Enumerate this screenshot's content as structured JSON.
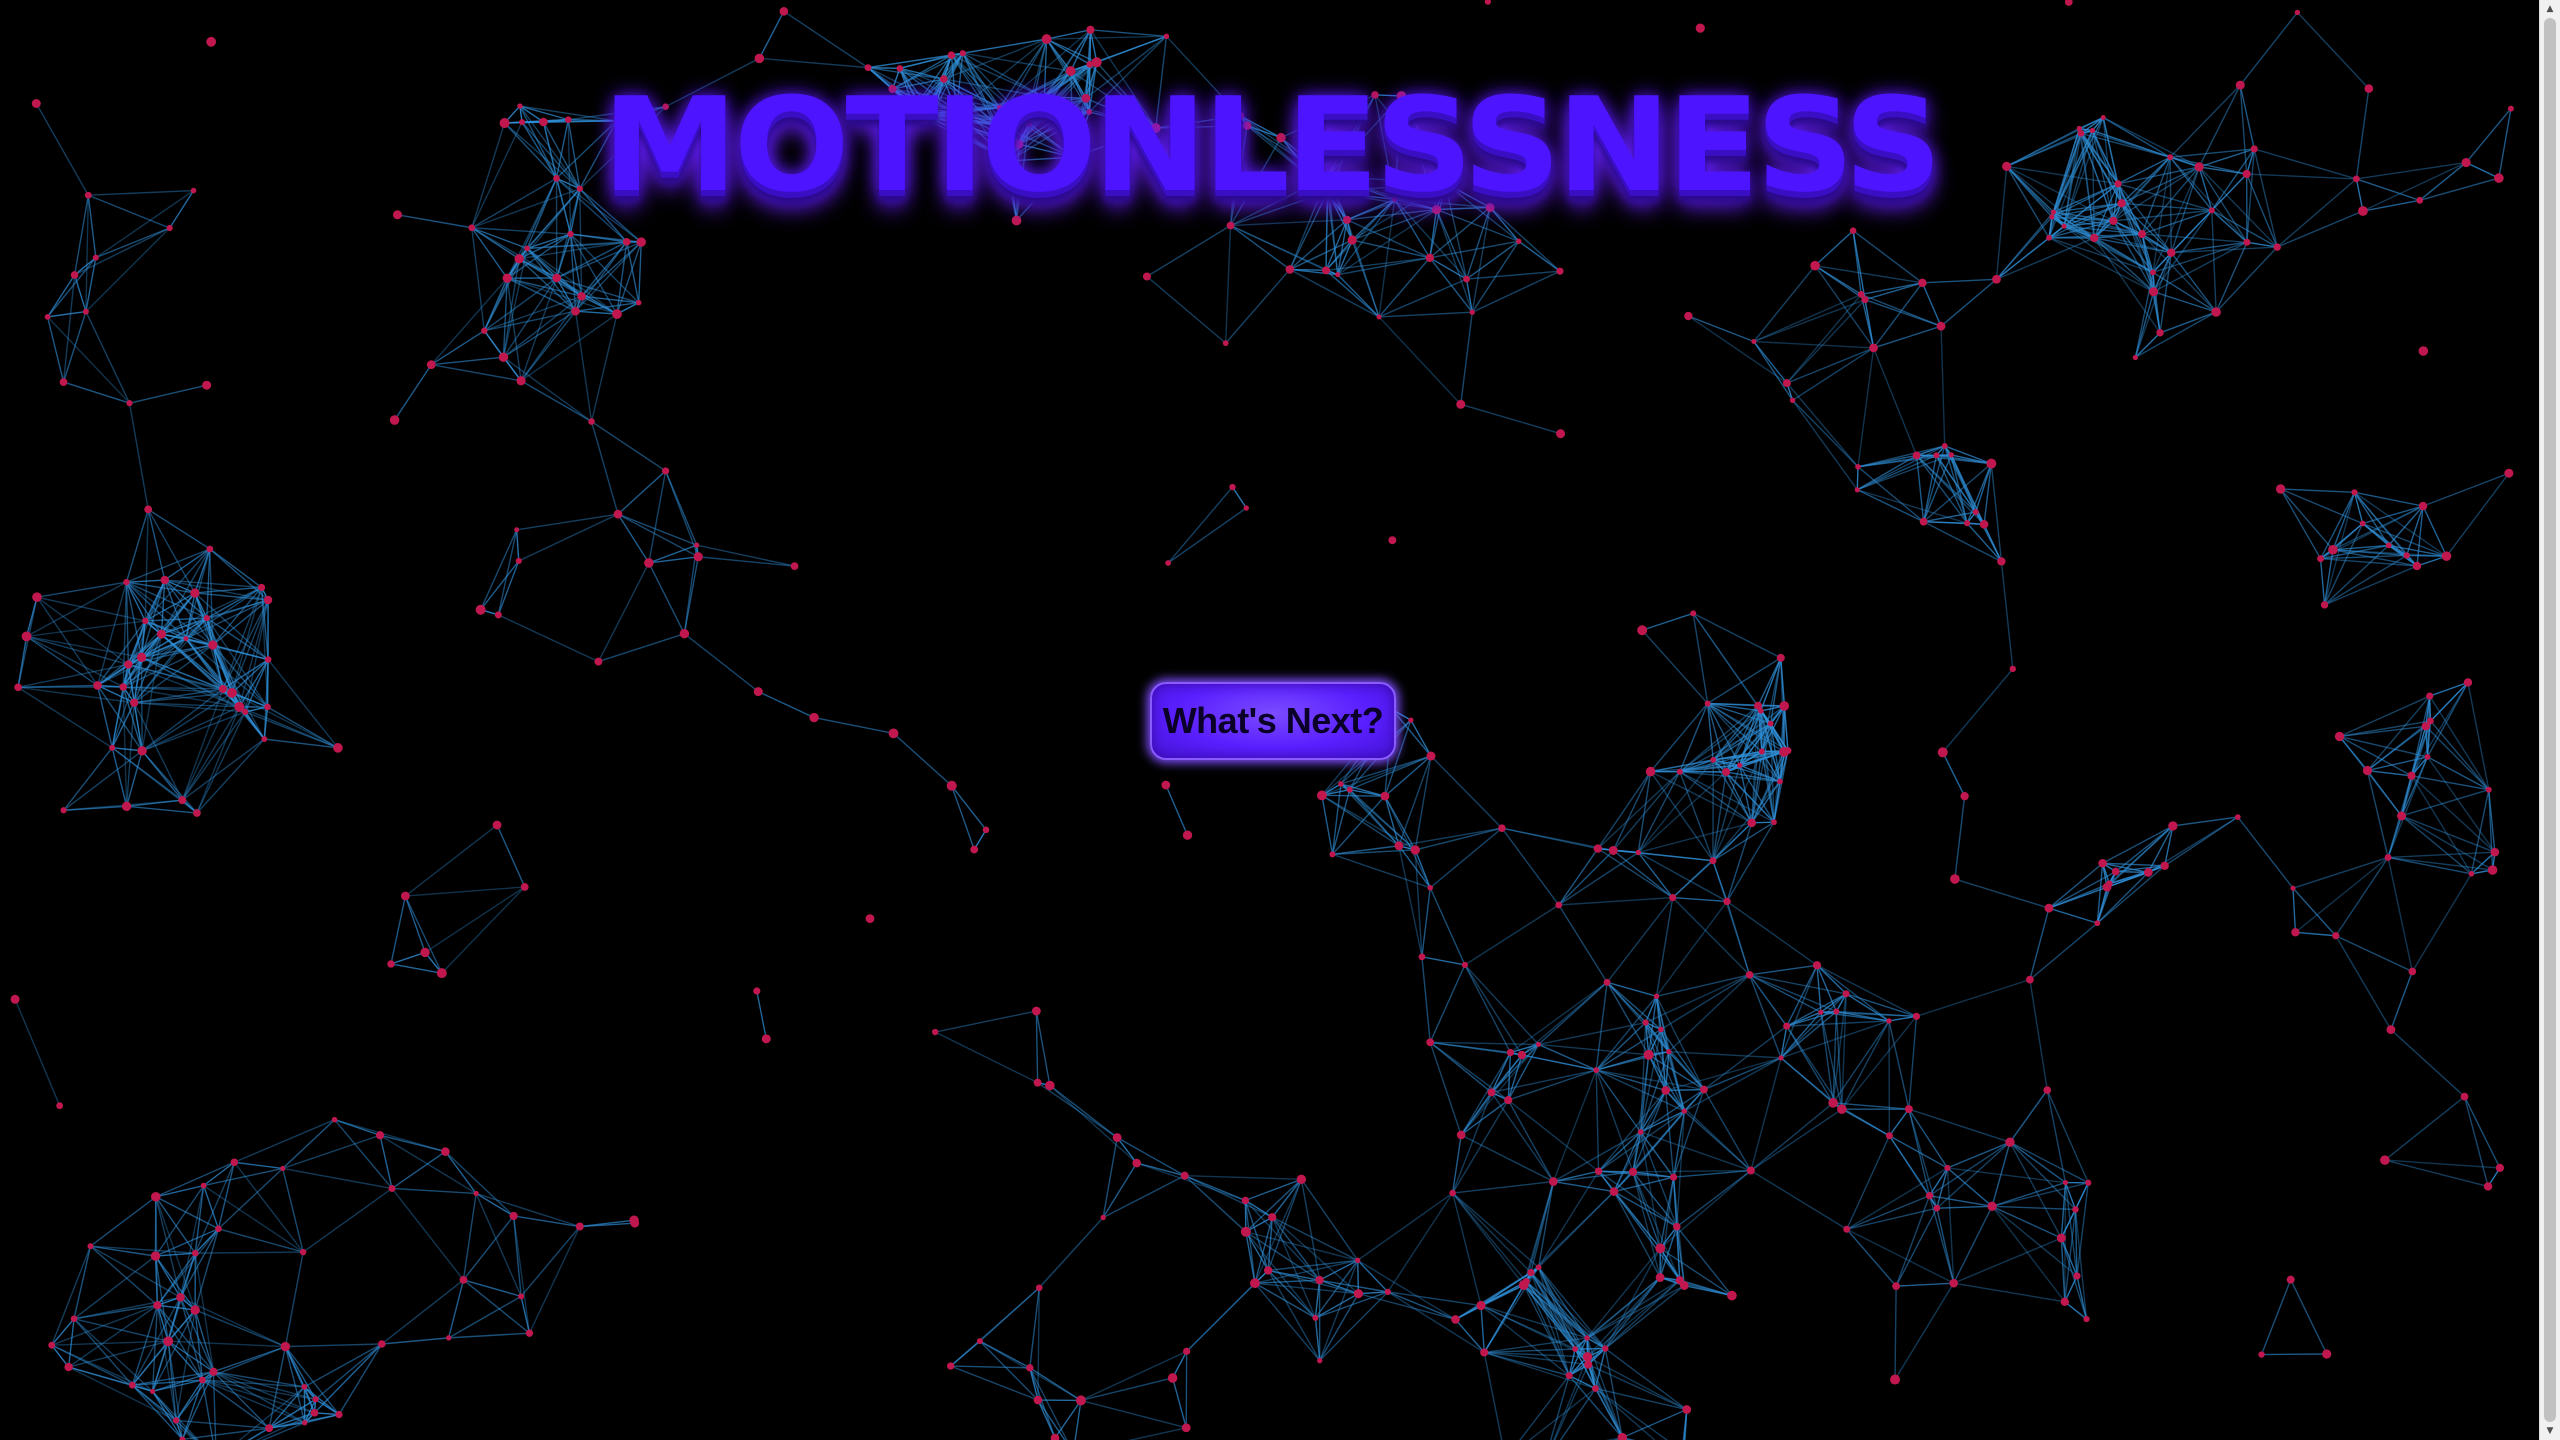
{
  "page": {
    "title": "MOTIONLESSNESS",
    "cta_label": "What's Next?"
  },
  "colors": {
    "background": "#000000",
    "title": "#4d14ff",
    "button": "#5a1fff",
    "link_line": "#2f8fd8",
    "node": "#c0184e"
  },
  "icons": {
    "scroll_up": "triangle-up-icon",
    "scroll_down": "triangle-down-icon"
  }
}
